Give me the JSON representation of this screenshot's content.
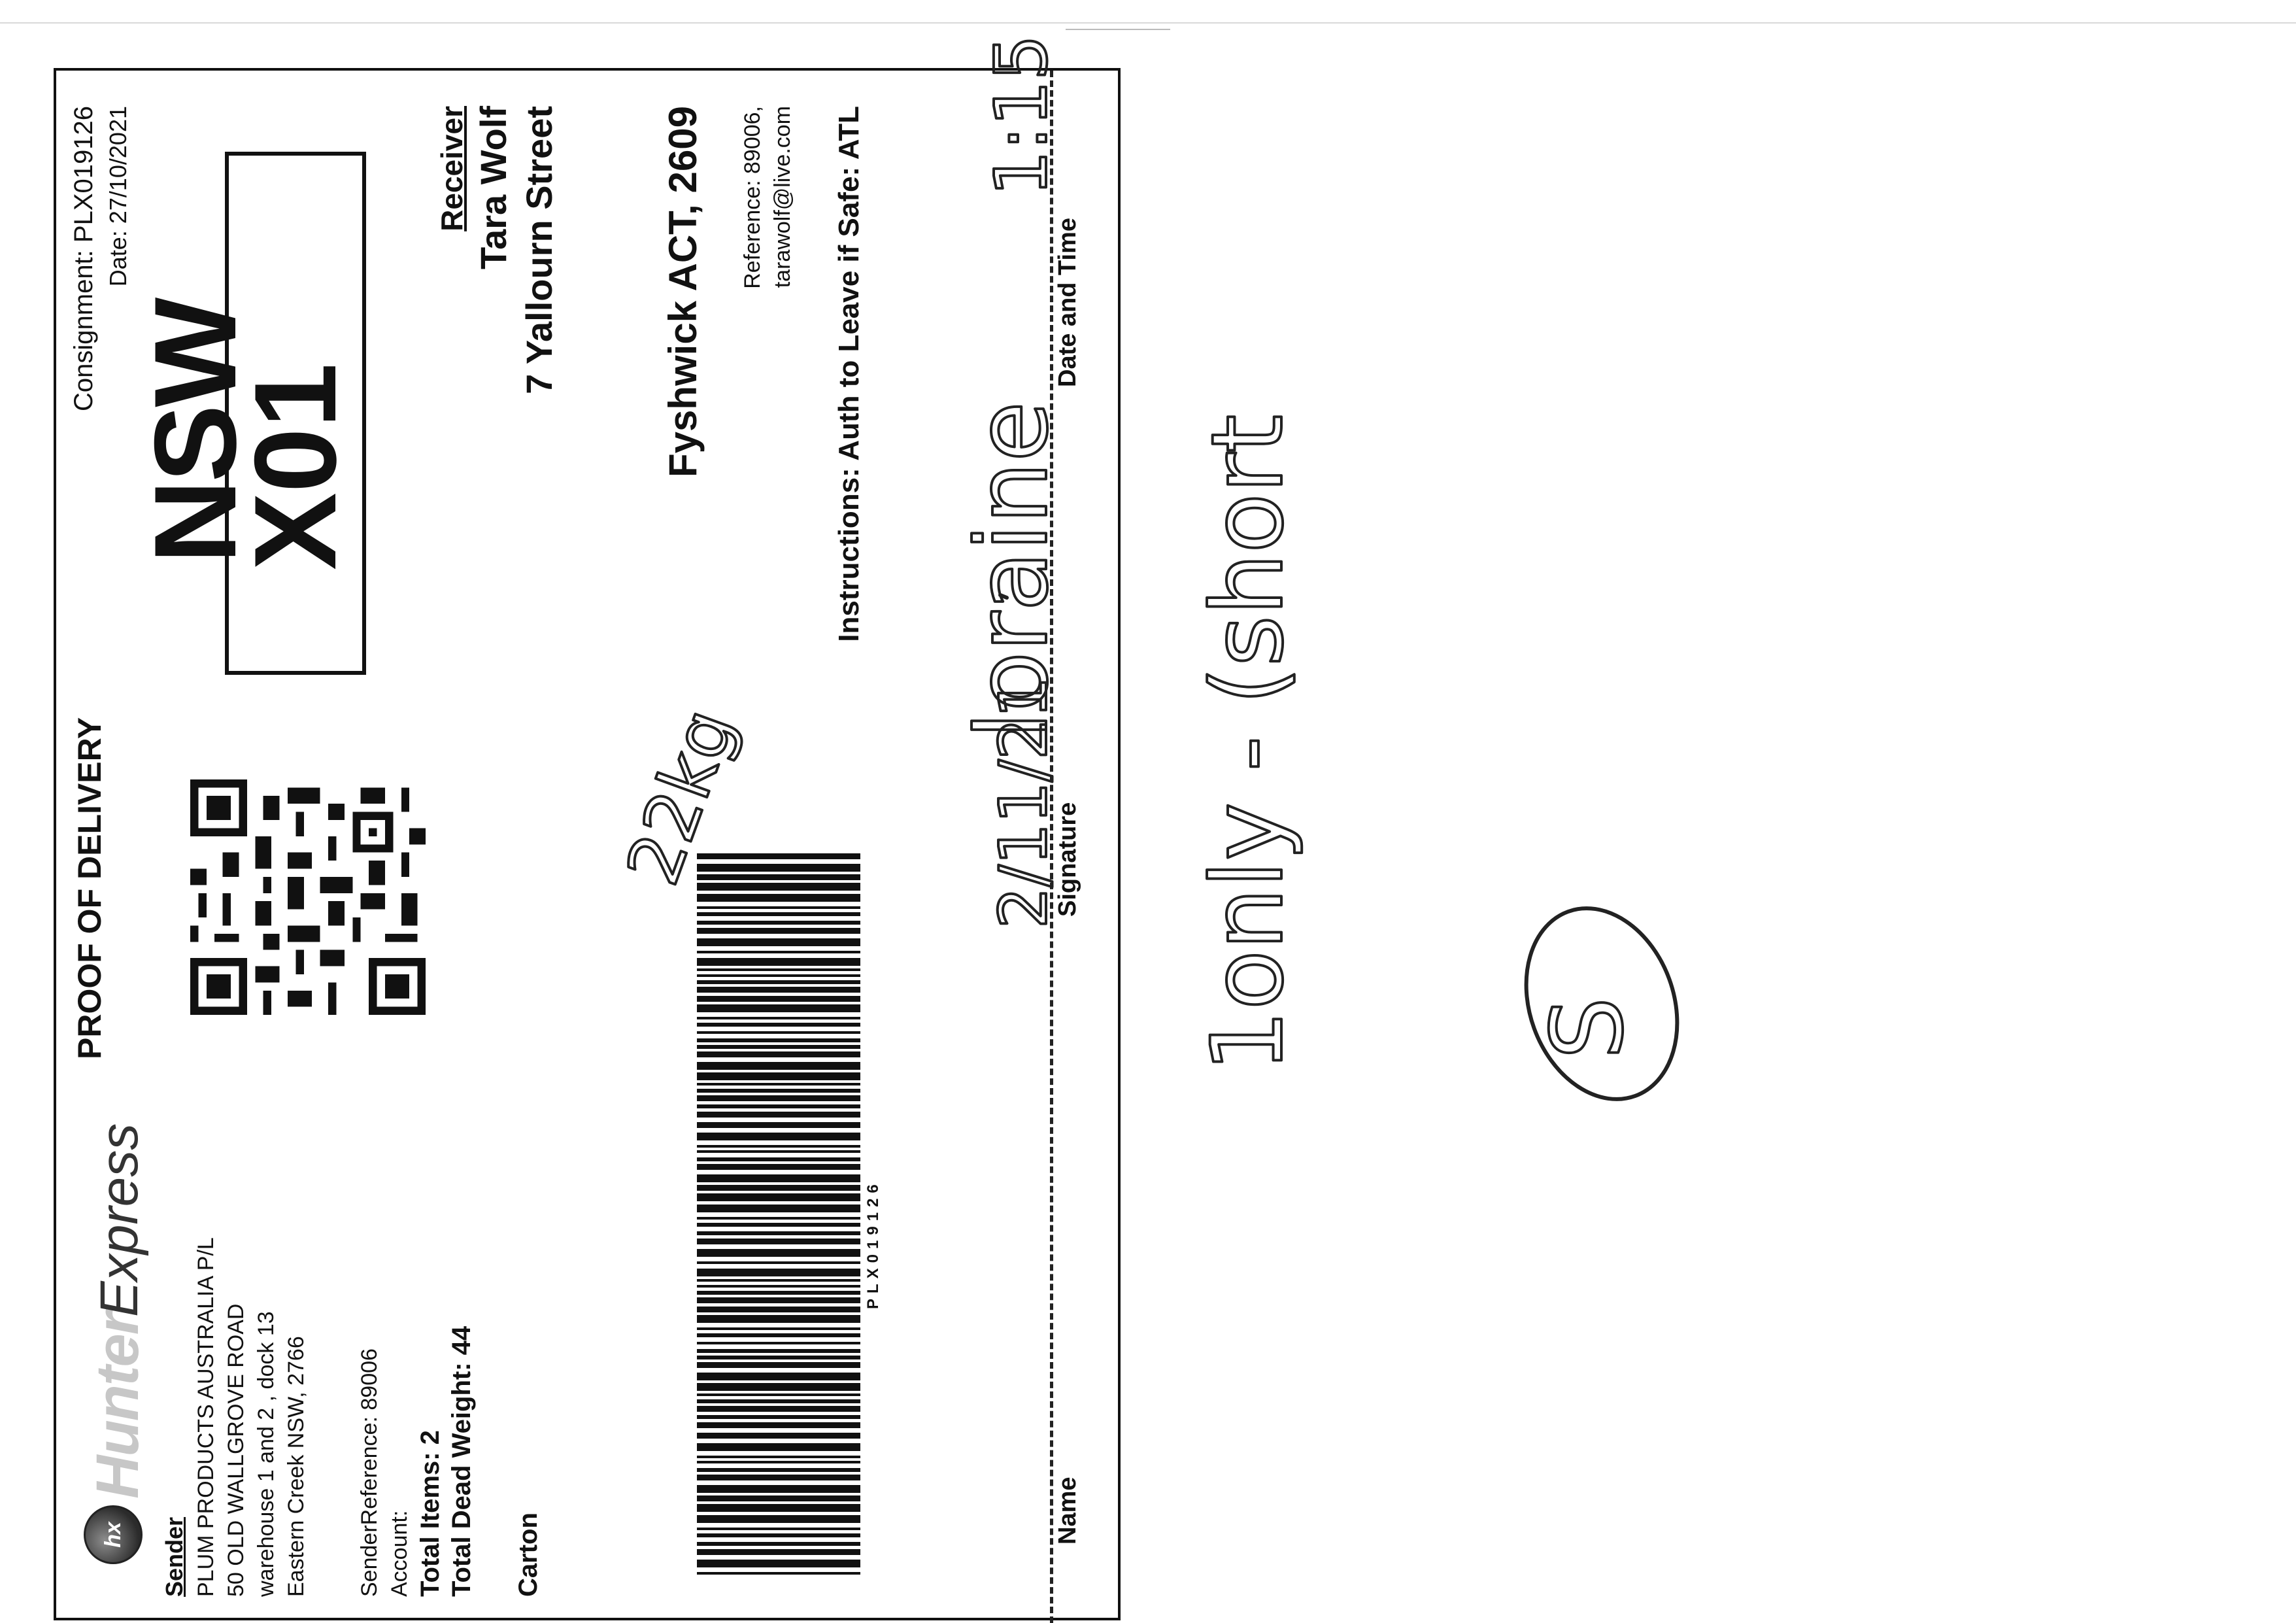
{
  "header": {
    "logo_brand": "Hunter",
    "logo_sub": "Express",
    "logo_mark": "hx",
    "title": "PROOF OF DELIVERY",
    "consignment": "Consignment: PLX019126",
    "date": "Date: 27/10/2021"
  },
  "routing": {
    "state": "NSW",
    "code": "X01"
  },
  "sender": {
    "label": "Sender",
    "lines": [
      "PLUM PRODUCTS AUSTRALIA P/L",
      "50 OLD WALLGROVE ROAD",
      "warehouse 1 and 2 , dock 13",
      "Eastern Creek NSW, 2766"
    ],
    "reference": "SenderReference: 89006",
    "account": "Account:",
    "total_items": "Total Items: 2",
    "total_weight": "Total Dead Weight: 44",
    "package_type": "Carton"
  },
  "receiver": {
    "label": "Receiver",
    "name": "Tara Wolf",
    "street": "7 Yallourn Street",
    "city": "Fyshwick ACT, 2609",
    "reference": "Reference: 89006,",
    "email": "tarawolf@live.com",
    "instructions": "Instructions: Auth to Leave if Safe: ATL"
  },
  "barcode": {
    "number": "PLX019126"
  },
  "signature_block": {
    "name_label": "Name",
    "signature_label": "Signature",
    "datetime_label": "Date and Time"
  },
  "handwriting": {
    "note_1": "1only - (short",
    "note_2": "loraine",
    "note_3": "2/11/21",
    "note_4": "1:15",
    "note_5": "22kg",
    "circled": "S"
  }
}
